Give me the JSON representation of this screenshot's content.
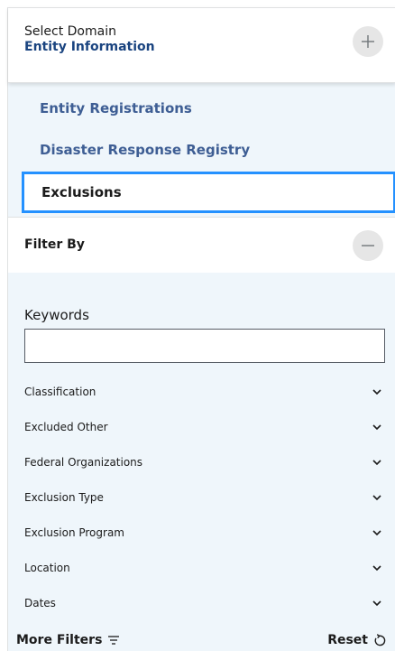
{
  "domain": {
    "label": "Select Domain",
    "value": "Entity Information",
    "expand_icon": "plus-icon",
    "items": [
      {
        "label": "Entity Registrations"
      },
      {
        "label": "Disaster Response Registry"
      },
      {
        "label": "Exclusions",
        "selected": true
      }
    ]
  },
  "filter": {
    "title": "Filter By",
    "collapse_icon": "minus-icon",
    "keywords_label": "Keywords",
    "keywords_value": "",
    "items": [
      {
        "label": "Classification"
      },
      {
        "label": "Excluded Other"
      },
      {
        "label": "Federal Organizations"
      },
      {
        "label": "Exclusion Type"
      },
      {
        "label": "Exclusion Program"
      },
      {
        "label": "Location"
      },
      {
        "label": "Dates"
      }
    ]
  },
  "footer": {
    "more_filters_label": "More Filters",
    "reset_label": "Reset"
  },
  "colors": {
    "panel_bg": "#eff6fb",
    "link": "#3e5e94",
    "domain_value": "#1a4480",
    "selected_border": "#2491ff"
  }
}
